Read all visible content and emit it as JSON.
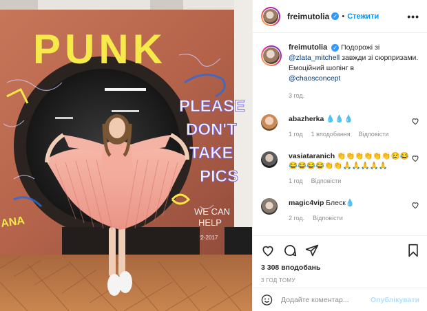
{
  "header": {
    "username": "freimutolia",
    "follow_label": "Стежити",
    "more_label": "•••"
  },
  "photo": {
    "wall_text": "PUNK",
    "graffiti_lines": [
      "PLEASE",
      "DON'T",
      "TAKE",
      "PICS"
    ],
    "we_can_help": [
      "WE CAN",
      "HELP"
    ],
    "date_tag": "11-22-2017"
  },
  "caption": {
    "username": "freimutolia",
    "text_before": "Подорожі зі",
    "mention1": "@zlata_mitchell",
    "text_middle": "завжди зі сюрпризами. Емоційний шопінг в",
    "mention2": "@chaosconcept",
    "time": "3 год."
  },
  "comments": [
    {
      "username": "abazherka",
      "text": "💧💧💧",
      "time": "1 год",
      "likes": "1 вподобання",
      "reply": "Відповісти"
    },
    {
      "username": "vasiataranich",
      "text": "👏👏👏👏👏👏😢😂😂😂😂😂👏👏🙏🙏🙏🙏🙏",
      "time": "1 год",
      "reply": "Відповісти"
    },
    {
      "username": "magic4vip",
      "text": "Блеск💧",
      "time": "2 год.",
      "reply": "Відповісти"
    }
  ],
  "actions": {
    "likes_count": "3 308 вподобань",
    "time_ago": "3 год тому"
  },
  "add_comment": {
    "placeholder": "Додайте коментар...",
    "post_label": "Опублікувати"
  },
  "colors": {
    "accent": "#0095f6",
    "verified": "#3897f0",
    "dress": "#f2a79a",
    "wall": "#b86b4e"
  }
}
